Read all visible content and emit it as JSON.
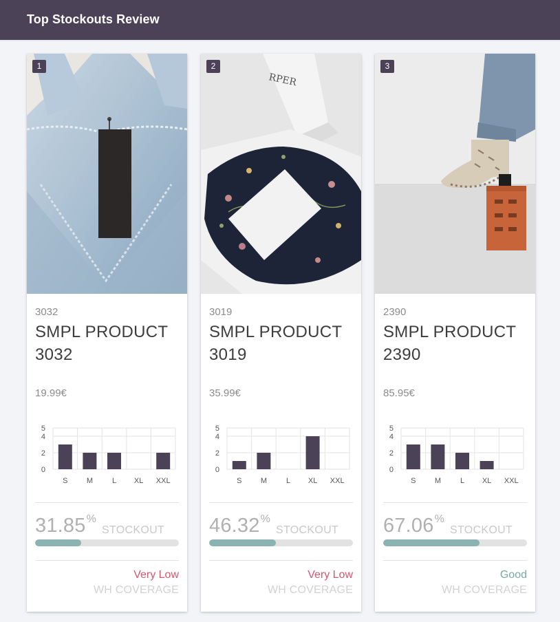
{
  "header": {
    "title": "Top Stockouts Review"
  },
  "colors": {
    "header_bg": "#4b4258",
    "bar": "#4b4258",
    "progress": "#8bb3b1",
    "coverage_bad": "#d7566d",
    "coverage_good": "#7aa8a3"
  },
  "stockout_label": "STOCKOUT",
  "coverage_label": "WH COVERAGE",
  "percent_sign": "%",
  "products": [
    {
      "rank": "1",
      "id": "3032",
      "name": "SMPL PRODUCT 3032",
      "price": "19.99€",
      "stockout_pct": "31.85",
      "stockout_fraction": 0.3185,
      "coverage": "Very Low",
      "coverage_status": "bad",
      "image": "denim-overalls-with-black-tag"
    },
    {
      "rank": "2",
      "id": "3019",
      "name": "SMPL PRODUCT 3019",
      "price": "35.99€",
      "stockout_pct": "46.32",
      "stockout_fraction": 0.4632,
      "coverage": "Very Low",
      "coverage_status": "bad",
      "image": "floral-top-in-white-box-with-card"
    },
    {
      "rank": "3",
      "id": "2390",
      "name": "SMPL PRODUCT 2390",
      "price": "85.95€",
      "stockout_pct": "67.06",
      "stockout_fraction": 0.6706,
      "coverage": "Good",
      "coverage_status": "good",
      "image": "snakeskin-ankle-boot-on-brick"
    }
  ],
  "chart_data": [
    {
      "type": "bar",
      "categories": [
        "S",
        "M",
        "L",
        "XL",
        "XXL"
      ],
      "values": [
        3,
        2,
        2,
        0,
        2
      ],
      "ylim": [
        0,
        5
      ],
      "yticks": [
        "0",
        "2",
        "4",
        "5"
      ],
      "grid": true
    },
    {
      "type": "bar",
      "categories": [
        "S",
        "M",
        "L",
        "XL",
        "XXL"
      ],
      "values": [
        1,
        2,
        0,
        4,
        0
      ],
      "ylim": [
        0,
        5
      ],
      "yticks": [
        "0",
        "2",
        "4",
        "5"
      ],
      "grid": true
    },
    {
      "type": "bar",
      "categories": [
        "S",
        "M",
        "L",
        "XL",
        "XXL"
      ],
      "values": [
        3,
        3,
        2,
        1,
        0
      ],
      "ylim": [
        0,
        5
      ],
      "yticks": [
        "0",
        "2",
        "4",
        "5"
      ],
      "grid": true
    }
  ]
}
